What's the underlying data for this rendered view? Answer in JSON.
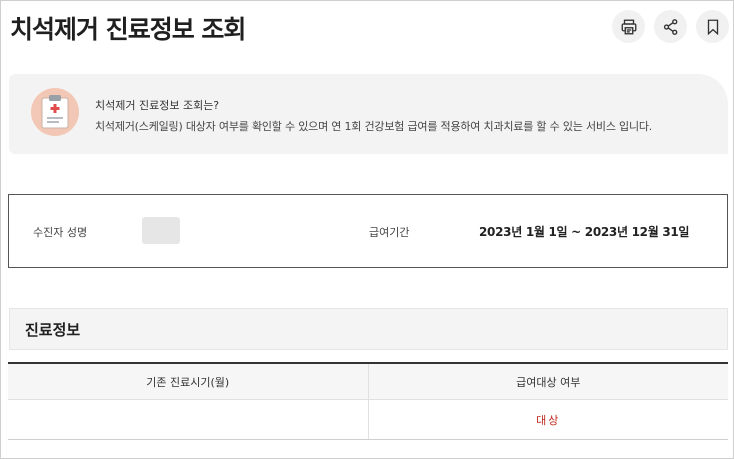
{
  "header": {
    "title": "치석제거 진료정보 조회",
    "icons": [
      "printer-icon",
      "share-icon",
      "bookmark-icon"
    ]
  },
  "info": {
    "title": "치석제거 진료정보 조회는?",
    "description": "치석제거(스케일링) 대상자 여부를 확인할 수 있으며 연 1회 건강보험 급여를 적용하여 치과치료를 할 수 있는 서비스 입니다."
  },
  "patient": {
    "name_label": "수진자 성명",
    "period_label": "급여기간",
    "period_value": "2023년 1월 1일 ~ 2023년 12월 31일"
  },
  "section": {
    "title": "진료정보"
  },
  "table": {
    "columns": [
      "기존 진료시기(월)",
      "급여대상 여부"
    ],
    "rows": [
      {
        "visit_month": "",
        "eligibility": "대상"
      }
    ]
  },
  "colors": {
    "accent_red": "#c0271e",
    "info_bg": "#f3f3f3",
    "icon_bg": "#f3c7b5"
  }
}
